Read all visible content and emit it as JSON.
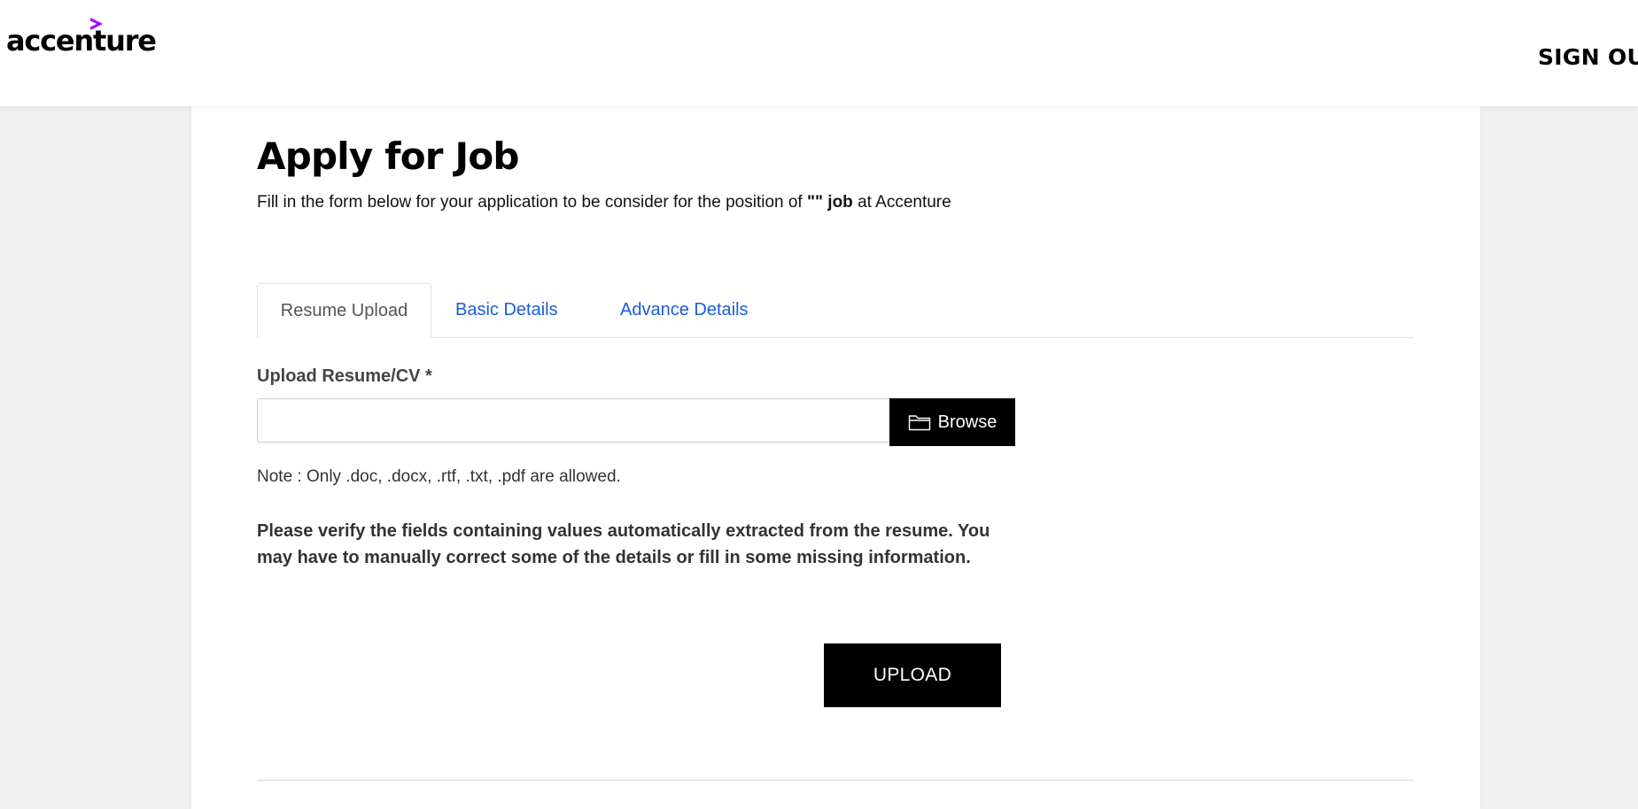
{
  "header": {
    "logo_text": "accenture",
    "logo_accent_color": "#a100ff",
    "signout_label": "SIGN OUT"
  },
  "main": {
    "title": "Apply for Job",
    "subtitle_prefix": "Fill in the form below for your application to be consider for the position of ",
    "subtitle_job": "\"\" job",
    "subtitle_suffix": " at Accenture",
    "tabs": [
      {
        "label": "Resume Upload",
        "active": true
      },
      {
        "label": "Basic Details",
        "active": false
      },
      {
        "label": "Advance Details",
        "active": false
      }
    ],
    "upload": {
      "field_label": "Upload Resume/CV *",
      "file_value": "",
      "browse_label": "Browse",
      "browse_icon": "folder-icon",
      "note": "Note : Only .doc, .docx, .rtf, .txt, .pdf are allowed.",
      "verify_text": "Please verify the fields containing values automatically extracted from the resume. You may have to manually correct some of the details or fill in some missing information.",
      "upload_label": "UPLOAD"
    }
  }
}
